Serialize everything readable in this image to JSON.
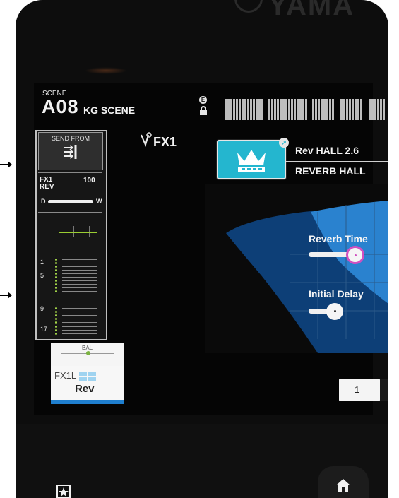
{
  "brand": {
    "text": "YAMA"
  },
  "scene": {
    "label": "SCENE",
    "number": "A08",
    "name": "KG SCENE"
  },
  "status": {
    "e_label": "E"
  },
  "strip": {
    "send_from_label": "SEND FROM",
    "fx_line1": "FX1",
    "fx_line2": "REV",
    "level": "100",
    "balance_left": "D",
    "balance_right": "W",
    "channel_numbers": [
      "1",
      "5",
      "9",
      "17"
    ],
    "bal_label": "BAL",
    "name_top": "FX1L",
    "name_bottom": "Rev"
  },
  "fx": {
    "title": "FX1",
    "preset_name": "Rev HALL 2.6",
    "preset_type": "REVERB HALL"
  },
  "params": [
    {
      "label": "Reverb Time"
    },
    {
      "label": "Initial Delay"
    }
  ],
  "page": {
    "number": "1"
  },
  "colors": {
    "accent": "#24b6cf",
    "knob_active": "#d050c0",
    "meter_green": "#a5d84a",
    "strip_blue": "#1f7fcf"
  },
  "icons": {
    "home": "home-icon",
    "scene": "scene-memory-icon",
    "lock": "lock-icon",
    "send": "send-from-icon"
  }
}
